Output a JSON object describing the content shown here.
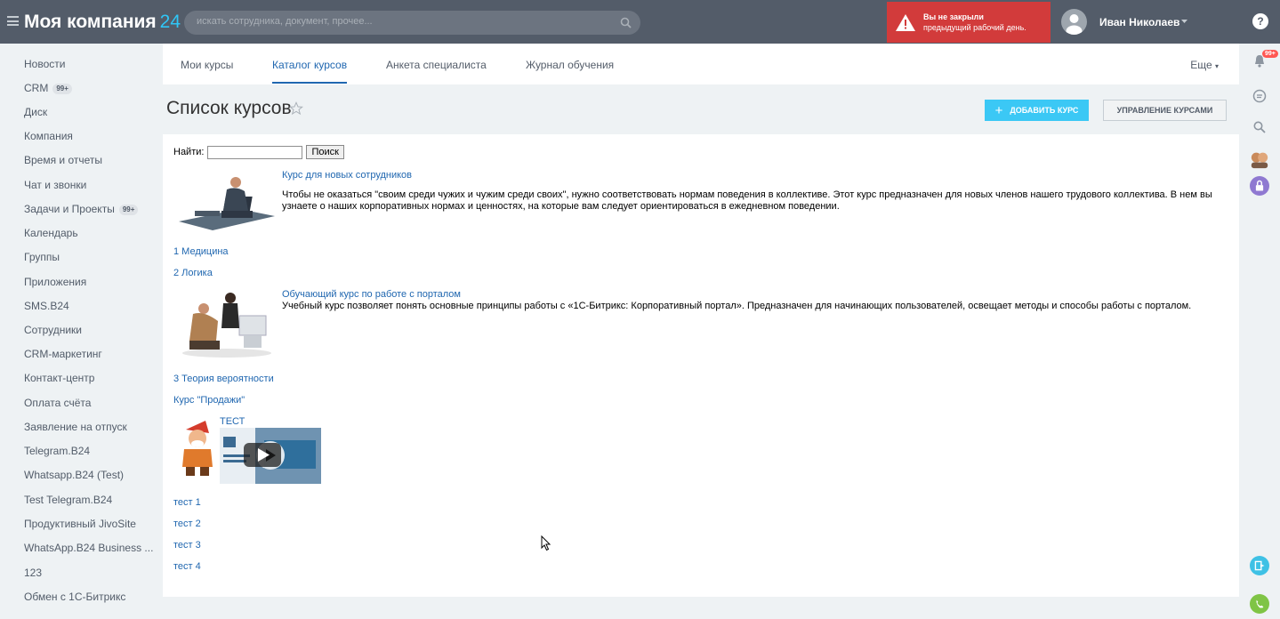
{
  "header": {
    "logo_text": "Моя компания",
    "logo_number": "24",
    "search_placeholder": "искать сотрудника, документ, прочее...",
    "alert_line1": "Вы не закрыли",
    "alert_line2": "предыдущий рабочий день.",
    "user_name": "Иван Николаев",
    "help_label": "?",
    "notifications_badge": "99+"
  },
  "sidebar": {
    "items": [
      {
        "label": "Новости"
      },
      {
        "label": "CRM",
        "badge": "99+"
      },
      {
        "label": "Диск"
      },
      {
        "label": "Компания"
      },
      {
        "label": "Время и отчеты"
      },
      {
        "label": "Чат и звонки"
      },
      {
        "label": "Задачи и Проекты",
        "badge": "99+"
      },
      {
        "label": "Календарь"
      },
      {
        "label": "Группы"
      },
      {
        "label": "Приложения"
      },
      {
        "label": "SMS.B24"
      },
      {
        "label": "Сотрудники"
      },
      {
        "label": "CRM-маркетинг"
      },
      {
        "label": "Контакт-центр"
      },
      {
        "label": "Оплата счёта"
      },
      {
        "label": "Заявление на отпуск"
      },
      {
        "label": "Telegram.B24"
      },
      {
        "label": "Whatsapp.B24 (Test)"
      },
      {
        "label": "Test Telegram.B24"
      },
      {
        "label": "Продуктивный JivoSite"
      },
      {
        "label": "WhatsApp.B24 Business ..."
      },
      {
        "label": "123"
      },
      {
        "label": "Обмен с 1С-Битрикс"
      }
    ]
  },
  "tabs": {
    "items": [
      {
        "label": "Мои курсы"
      },
      {
        "label": "Каталог курсов"
      },
      {
        "label": "Анкета специалиста"
      },
      {
        "label": "Журнал обучения"
      }
    ],
    "more_label": "Еще"
  },
  "page": {
    "title": "Список курсов",
    "add_button": "ДОБАВИТЬ КУРС",
    "manage_button": "УПРАВЛЕНИЕ КУРСАМИ"
  },
  "search_form": {
    "label": "Найти:",
    "value": "",
    "button": "Поиск"
  },
  "courses": {
    "course1_title": "Курс для новых сотрудников",
    "course1_desc": "Чтобы не оказаться \"своим среди чужих и чужим среди своих\", нужно соответствовать нормам поведения в коллективе. Этот курс предназначен для новых членов нашего трудового коллектива. В нем вы узнаете о наших корпоративных нормах и ценностях, на которые вам следует ориентироваться в ежедневном поведении.",
    "link1": "1 Медицина",
    "link2": "2 Логика",
    "course2_title": "Обучающий курс по работе с порталом",
    "course2_desc": "Учебный курс позволяет понять основные принципы работы с «1С-Битрикс: Корпоративный портал». Предназначен для начинающих пользователей, освещает методы и способы работы с порталом.",
    "link3": "3 Теория вероятности",
    "link4": "Курс \"Продажи\"",
    "course3_title": "ТЕСТ",
    "test1": "тест 1",
    "test2": "тест 2",
    "test3": "тест 3",
    "test4": "тест 4"
  },
  "colors": {
    "topbar": "#535c69",
    "accent": "#2fc6f6",
    "alert": "#d23b3b",
    "link": "#2067b0",
    "add_button": "#3bc8f5"
  }
}
